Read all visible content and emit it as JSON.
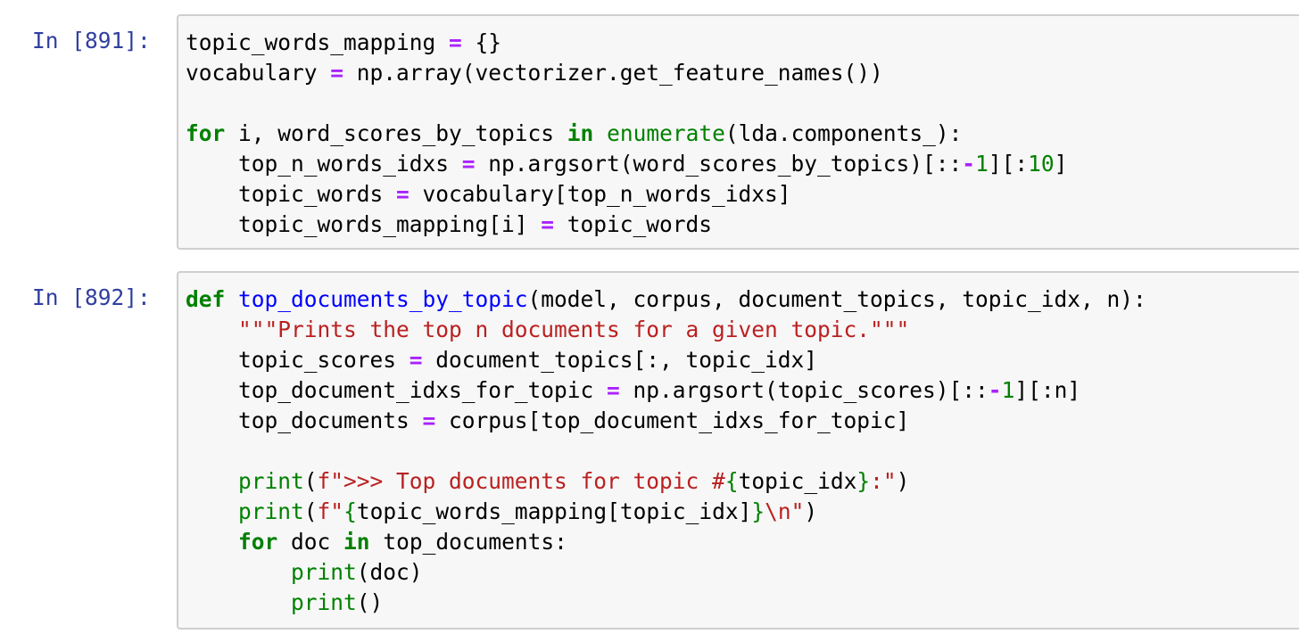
{
  "cells": [
    {
      "prompt": "In [891]:",
      "lines": [
        [
          {
            "t": "topic_words_mapping "
          },
          {
            "t": "=",
            "c": "op"
          },
          {
            "t": " {}"
          }
        ],
        [
          {
            "t": "vocabulary "
          },
          {
            "t": "=",
            "c": "op"
          },
          {
            "t": " np.array(vectorizer.get_feature_names())"
          }
        ],
        [],
        [
          {
            "t": "for",
            "c": "kw"
          },
          {
            "t": " i, word_scores_by_topics "
          },
          {
            "t": "in",
            "c": "kw"
          },
          {
            "t": " "
          },
          {
            "t": "enumerate",
            "c": "bi"
          },
          {
            "t": "(lda.components_):"
          }
        ],
        [
          {
            "t": "    top_n_words_idxs "
          },
          {
            "t": "=",
            "c": "op"
          },
          {
            "t": " np.argsort(word_scores_by_topics)[::"
          },
          {
            "t": "-",
            "c": "op"
          },
          {
            "t": "1",
            "c": "num"
          },
          {
            "t": "][:"
          },
          {
            "t": "10",
            "c": "num"
          },
          {
            "t": "]"
          }
        ],
        [
          {
            "t": "    topic_words "
          },
          {
            "t": "=",
            "c": "op"
          },
          {
            "t": " vocabulary[top_n_words_idxs]"
          }
        ],
        [
          {
            "t": "    topic_words_mapping[i] "
          },
          {
            "t": "=",
            "c": "op"
          },
          {
            "t": " topic_words"
          }
        ]
      ]
    },
    {
      "prompt": "In [892]:",
      "lines": [
        [
          {
            "t": "def",
            "c": "kw"
          },
          {
            "t": " "
          },
          {
            "t": "top_documents_by_topic",
            "c": "fn"
          },
          {
            "t": "(model, corpus, document_topics, topic_idx, n):"
          }
        ],
        [
          {
            "t": "    "
          },
          {
            "t": "\"\"\"Prints the top n documents for a given topic.\"\"\"",
            "c": "str"
          }
        ],
        [
          {
            "t": "    topic_scores "
          },
          {
            "t": "=",
            "c": "op"
          },
          {
            "t": " document_topics[:, topic_idx]"
          }
        ],
        [
          {
            "t": "    top_document_idxs_for_topic "
          },
          {
            "t": "=",
            "c": "op"
          },
          {
            "t": " np.argsort(topic_scores)[::"
          },
          {
            "t": "-",
            "c": "op"
          },
          {
            "t": "1",
            "c": "num"
          },
          {
            "t": "][:n]"
          }
        ],
        [
          {
            "t": "    top_documents "
          },
          {
            "t": "=",
            "c": "op"
          },
          {
            "t": " corpus[top_document_idxs_for_topic]"
          }
        ],
        [],
        [
          {
            "t": "    "
          },
          {
            "t": "print",
            "c": "bi"
          },
          {
            "t": "("
          },
          {
            "t": "f\">>> Top documents for topic #",
            "c": "str"
          },
          {
            "t": "{",
            "c": "int"
          },
          {
            "t": "topic_idx"
          },
          {
            "t": "}",
            "c": "int"
          },
          {
            "t": ":\"",
            "c": "str"
          },
          {
            "t": ")"
          }
        ],
        [
          {
            "t": "    "
          },
          {
            "t": "print",
            "c": "bi"
          },
          {
            "t": "("
          },
          {
            "t": "f\"",
            "c": "str"
          },
          {
            "t": "{",
            "c": "int"
          },
          {
            "t": "topic_words_mapping[topic_idx]"
          },
          {
            "t": "}",
            "c": "int"
          },
          {
            "t": "\\n\"",
            "c": "str"
          },
          {
            "t": ")"
          }
        ],
        [
          {
            "t": "    "
          },
          {
            "t": "for",
            "c": "kw"
          },
          {
            "t": " doc "
          },
          {
            "t": "in",
            "c": "kw"
          },
          {
            "t": " top_documents:"
          }
        ],
        [
          {
            "t": "        "
          },
          {
            "t": "print",
            "c": "bi"
          },
          {
            "t": "(doc)"
          }
        ],
        [
          {
            "t": "        "
          },
          {
            "t": "print",
            "c": "bi"
          },
          {
            "t": "()"
          }
        ]
      ]
    }
  ]
}
